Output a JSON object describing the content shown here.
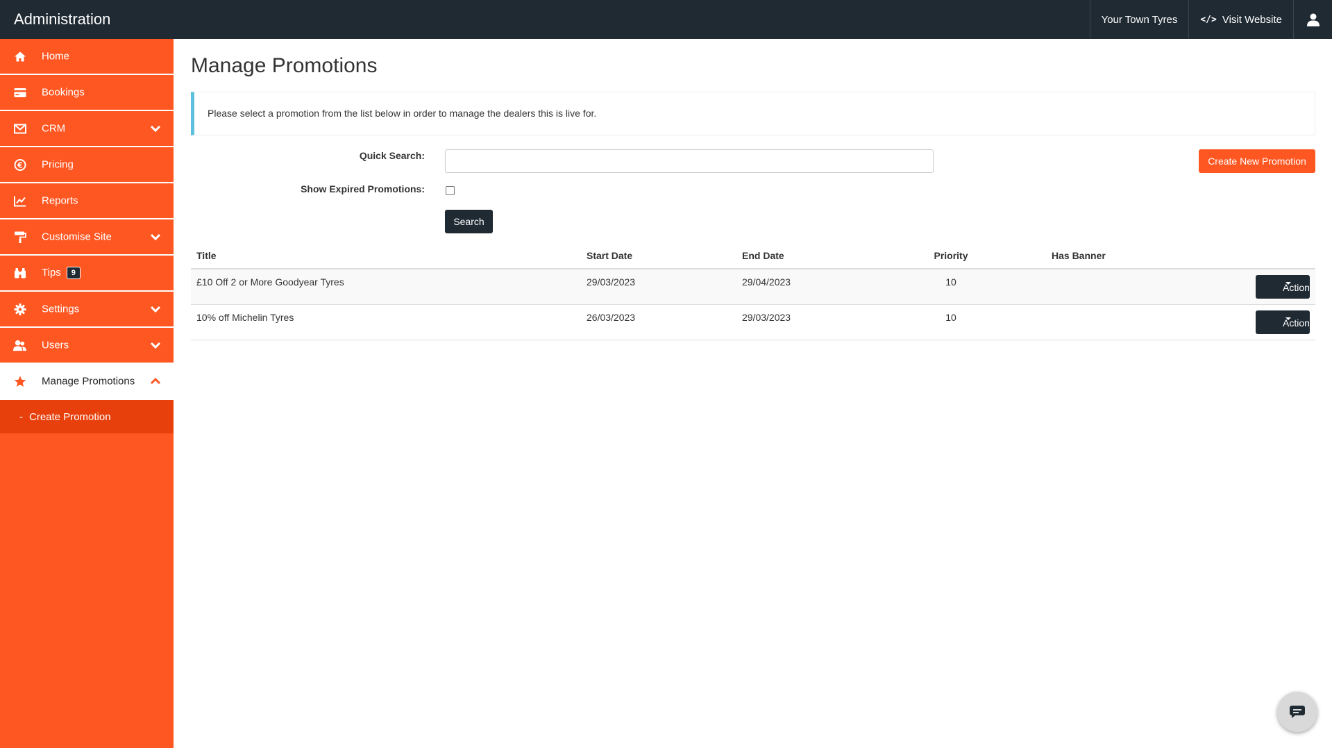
{
  "topbar": {
    "title": "Administration",
    "dealer_name": "Your Town Tyres",
    "visit_website": "Visit Website"
  },
  "sidebar": {
    "items": [
      {
        "label": "Home",
        "icon": "home-icon"
      },
      {
        "label": "Bookings",
        "icon": "credit-card-icon"
      },
      {
        "label": "CRM",
        "icon": "envelope-icon",
        "expandable": true
      },
      {
        "label": "Pricing",
        "icon": "euro-icon"
      },
      {
        "label": "Reports",
        "icon": "chart-icon"
      },
      {
        "label": "Customise Site",
        "icon": "paint-roller-icon",
        "expandable": true
      },
      {
        "label": "Tips",
        "icon": "binoculars-icon",
        "badge": "9"
      },
      {
        "label": "Settings",
        "icon": "gear-icon",
        "expandable": true
      },
      {
        "label": "Users",
        "icon": "users-icon",
        "expandable": true
      },
      {
        "label": "Manage Promotions",
        "icon": "star-icon",
        "expandable": true,
        "expanded": true
      }
    ],
    "sub_items": [
      {
        "label": "Create Promotion",
        "prefix": "-"
      }
    ]
  },
  "main": {
    "title": "Manage Promotions",
    "info": "Please select a promotion from the list below in order to manage the dealers this is live for.",
    "quick_search_label": "Quick Search:",
    "quick_search_value": "",
    "show_expired_label": "Show Expired Promotions:",
    "show_expired_checked": false,
    "search_button": "Search",
    "create_button": "Create New Promotion"
  },
  "table": {
    "headers": [
      "Title",
      "Start Date",
      "End Date",
      "Priority",
      "Has Banner"
    ],
    "rows": [
      {
        "title": "£10 Off 2 or More Goodyear Tyres",
        "start": "29/03/2023",
        "end": "29/04/2023",
        "priority": "10",
        "banner": "",
        "action": "Action"
      },
      {
        "title": "10% off Michelin Tyres",
        "start": "26/03/2023",
        "end": "29/03/2023",
        "priority": "10",
        "banner": "",
        "action": "Action"
      }
    ]
  },
  "colors": {
    "accent": "#ff5722",
    "accent_dark": "#e8400c",
    "topbar": "#1f2a33",
    "info_border": "#5bc0de"
  }
}
